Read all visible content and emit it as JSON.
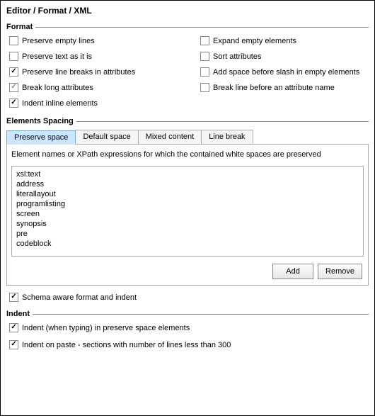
{
  "breadcrumb": "Editor / Format / XML",
  "groups": {
    "format": {
      "title": "Format"
    },
    "elements_spacing": {
      "title": "Elements Spacing"
    },
    "indent": {
      "title": "Indent"
    }
  },
  "format_options": {
    "left": [
      {
        "label": "Preserve empty lines",
        "checked": false
      },
      {
        "label": "Preserve text as it is",
        "checked": false
      },
      {
        "label": "Preserve line breaks in attributes",
        "checked": true
      },
      {
        "label": "Break long attributes",
        "checked": true,
        "gray": true
      },
      {
        "label": "Indent inline elements",
        "checked": true
      }
    ],
    "right": [
      {
        "label": "Expand empty elements",
        "checked": false
      },
      {
        "label": "Sort attributes",
        "checked": false
      },
      {
        "label": "Add space before slash in empty elements",
        "checked": false
      },
      {
        "label": "Break line before an attribute name",
        "checked": false
      }
    ]
  },
  "tabs": [
    {
      "label": "Preserve space",
      "active": true
    },
    {
      "label": "Default space",
      "active": false
    },
    {
      "label": "Mixed content",
      "active": false
    },
    {
      "label": "Line break",
      "active": false
    }
  ],
  "tab_description": "Element names or XPath expressions for which the contained white spaces are preserved",
  "list_items": [
    "xsl:text",
    "address",
    "literallayout",
    "programlisting",
    "screen",
    "synopsis",
    "pre",
    "codeblock"
  ],
  "buttons": {
    "add": "Add",
    "remove": "Remove"
  },
  "schema_aware": {
    "label": "Schema aware format and indent",
    "checked": true
  },
  "indent_options": [
    {
      "label": "Indent (when typing) in preserve space elements",
      "checked": true
    },
    {
      "label": "Indent on paste - sections with number of lines less than 300",
      "checked": true
    }
  ]
}
